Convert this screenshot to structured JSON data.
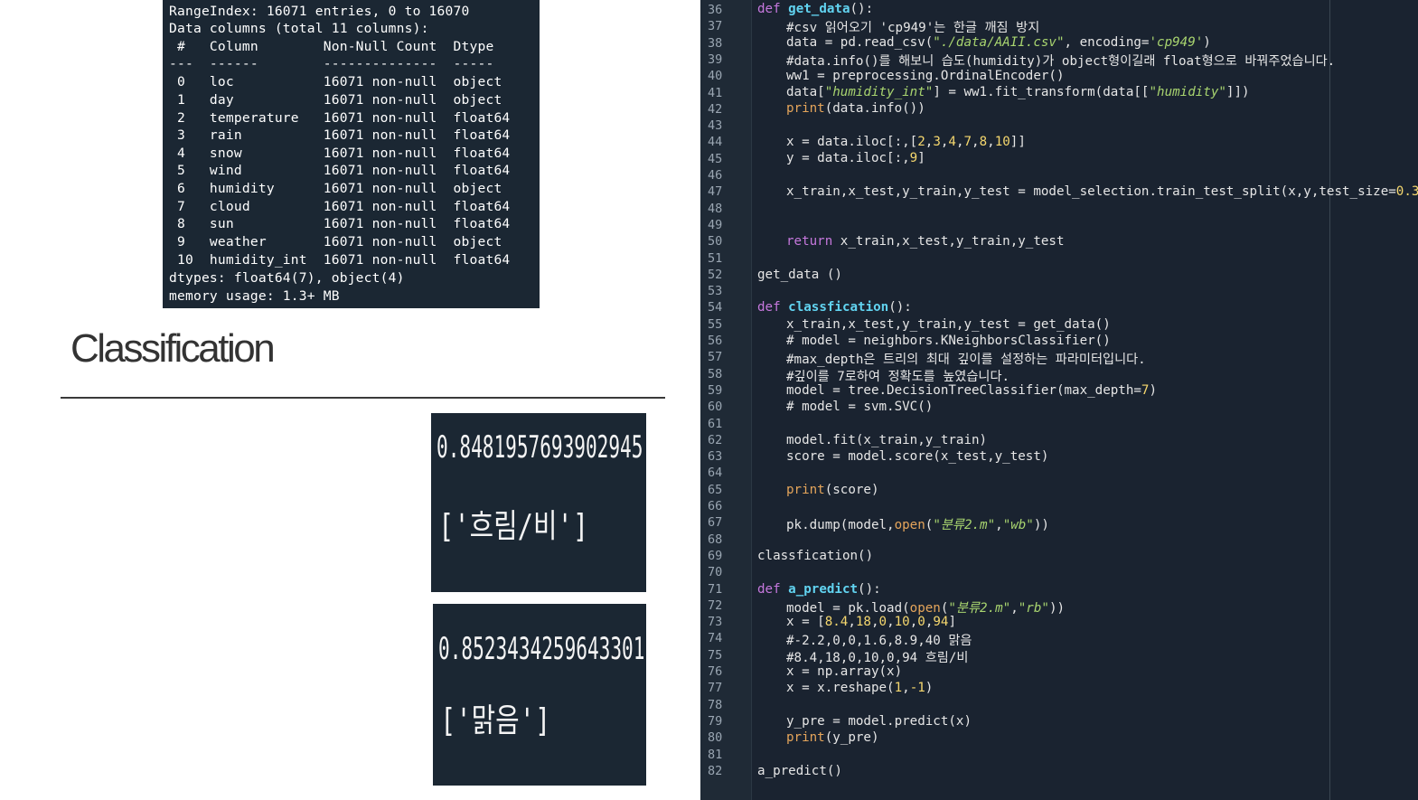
{
  "info_panel": {
    "lines": [
      "RangeIndex: 16071 entries, 0 to 16070",
      "Data columns (total 11 columns):",
      " #   Column        Non-Null Count  Dtype",
      "---  ------        --------------  -----",
      " 0   loc           16071 non-null  object",
      " 1   day           16071 non-null  object",
      " 2   temperature   16071 non-null  float64",
      " 3   rain          16071 non-null  float64",
      " 4   snow          16071 non-null  float64",
      " 5   wind          16071 non-null  float64",
      " 6   humidity      16071 non-null  object",
      " 7   cloud         16071 non-null  float64",
      " 8   sun           16071 non-null  float64",
      " 9   weather       16071 non-null  object",
      " 10  humidity_int  16071 non-null  float64",
      "dtypes: float64(7), object(4)",
      "memory usage: 1.3+ MB"
    ]
  },
  "heading": "Classification",
  "results": [
    {
      "score": "0.8481957693902945",
      "label": "['흐림/비']"
    },
    {
      "score": "0.8523434259643301",
      "label": "['맑음']"
    }
  ],
  "editor": {
    "line_numbers": [
      "36",
      "37",
      "38",
      "39",
      "40",
      "41",
      "42",
      "43",
      "44",
      "45",
      "46",
      "47",
      "48",
      "49",
      "50",
      "51",
      "52",
      "53",
      "54",
      "55",
      "56",
      "57",
      "58",
      "59",
      "60",
      "61",
      "62",
      "63",
      "64",
      "65",
      "66",
      "67",
      "68",
      "69",
      "70",
      "71",
      "72",
      "73",
      "74",
      "75",
      "76",
      "77",
      "78",
      "79",
      "80",
      "81",
      "82"
    ],
    "code": {
      "l36_kw": "def",
      "l36_fn": "get_data",
      "l36_rest": "():",
      "l37": "#csv 읽어오기 'cp949'는 한글 깨짐 방지",
      "l38_a": "data = pd.read_csv(",
      "l38_s1": "\"./data/AAII.csv\"",
      "l38_b": ", encoding=",
      "l38_s2": "'cp949'",
      "l38_c": ")",
      "l39": "#data.info()를 해보니 습도(humidity)가 object형이길래 float형으로 바꿔주었습니다.",
      "l40": "ww1 = preprocessing.OrdinalEncoder()",
      "l41_a": "data[",
      "l41_s1": "\"humidity_int\"",
      "l41_b": "] = ww1.fit_transform(data[[",
      "l41_s2": "\"humidity\"",
      "l41_c": "]])",
      "l42_bi": "print",
      "l42_rest": "(data.info())",
      "l44_a": "x = data.iloc[:,[",
      "l44_n": [
        "2",
        "3",
        "4",
        "7",
        "8",
        "10"
      ],
      "l44_c": "]]",
      "l45_a": "y = data.iloc[:,",
      "l45_n": "9",
      "l45_c": "]",
      "l47_a": "x_train,x_test,y_train,y_test = model_selection.train_test_split(x,y,test_size=",
      "l47_n": "0.3",
      "l47_c": ")",
      "l50_kw": "return",
      "l50_rest": " x_train,x_test,y_train,y_test",
      "l52": "get_data ()",
      "l54_kw": "def",
      "l54_fn": "classfication",
      "l54_rest": "():",
      "l55": "x_train,x_test,y_train,y_test = get_data()",
      "l56": "# model = neighbors.KNeighborsClassifier()",
      "l57": "#max_depth은 트리의 최대 깊이를 설정하는 파라미터입니다.",
      "l58": "#깊이를 7로하여 정확도를 높였습니다.",
      "l59_a": "model = tree.DecisionTreeClassifier(max_depth=",
      "l59_n": "7",
      "l59_c": ")",
      "l60": "# model = svm.SVC()",
      "l62": "model.fit(x_train,y_train)",
      "l63": "score = model.score(x_test,y_test)",
      "l65_bi": "print",
      "l65_rest": "(score)",
      "l67_a": "pk.dump(model,",
      "l67_bi": "open",
      "l67_b": "(",
      "l67_s1": "\"분류2.m\"",
      "l67_c": ",",
      "l67_s2": "\"wb\"",
      "l67_d": "))",
      "l69": "classfication()",
      "l71_kw": "def",
      "l71_fn": "a_predict",
      "l71_rest": "():",
      "l72_a": "model = pk.load(",
      "l72_bi": "open",
      "l72_b": "(",
      "l72_s1": "\"분류2.m\"",
      "l72_c": ",",
      "l72_s2": "\"rb\"",
      "l72_d": "))",
      "l73_a": "x = [",
      "l73_n": [
        "8.4",
        "18",
        "0",
        "10",
        "0",
        "94"
      ],
      "l73_c": "]",
      "l74": "#-2.2,0,0,1.6,8.9,40 맑음",
      "l75": "#8.4,18,0,10,0,94 흐림/비",
      "l76": "x = np.array(x)",
      "l77_a": "x = x.reshape(",
      "l77_n1": "1",
      "l77_b": ",",
      "l77_n2": "-1",
      "l77_c": ")",
      "l79": "y_pre = model.predict(x)",
      "l80_bi": "print",
      "l80_rest": "(y_pre)",
      "l82": "a_predict()"
    }
  },
  "colors": {
    "panel_bg": "#1b2733",
    "editor_bg": "#1a2330",
    "keyword": "#c678dd",
    "function": "#61d3f0",
    "builtin": "#e5a55b",
    "string": "#a8d46f",
    "number": "#f5d76e",
    "comment": "#7b8794"
  }
}
